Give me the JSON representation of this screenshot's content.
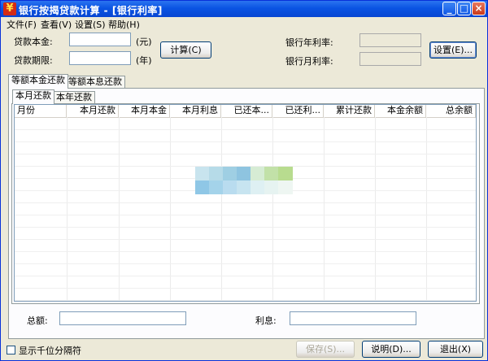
{
  "window": {
    "title": "银行按揭贷款计算  - [银行利率]",
    "app_icon_glyph": "¥",
    "minimize_glyph": "_",
    "maximize_glyph": "□",
    "close_glyph": "×"
  },
  "menu": [
    "文件(F)",
    "查看(V)",
    "设置(S)",
    "帮助(H)"
  ],
  "form": {
    "principal_label": "贷款本金:",
    "principal_value": "",
    "principal_unit": "(元)",
    "term_label": "贷款期限:",
    "term_value": "",
    "term_unit": "(年)",
    "calc_button": "计算(C)",
    "annual_rate_label": "银行年利率:",
    "annual_rate_value": "",
    "monthly_rate_label": "银行月利率:",
    "monthly_rate_value": "",
    "settings_button": "设置(E)..."
  },
  "tabs": {
    "outer": [
      "等额本金还款",
      "等额本息还款"
    ],
    "outer_active": 0,
    "inner": [
      "本月还款",
      "本年还款"
    ],
    "inner_active": 0
  },
  "table": {
    "columns": [
      "月份",
      "本月还款",
      "本月本金",
      "本月利息",
      "已还本...",
      "已还利...",
      "累计还款",
      "本金余额",
      "总余额"
    ],
    "rows": []
  },
  "totals": {
    "total_label": "总额:",
    "total_value": "",
    "interest_label": "利息:",
    "interest_value": ""
  },
  "footer": {
    "thousands_checkbox_label": "显示千位分隔符",
    "thousands_checked": false,
    "save_button": "保存(S)...",
    "help_button": "说明(D)...",
    "exit_button": "退出(X)"
  },
  "colors": {
    "titlebar": "#0a54e3",
    "window_bg": "#ece9d8",
    "grid_line": "#efefef"
  }
}
